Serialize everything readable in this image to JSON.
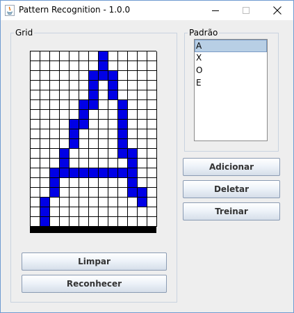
{
  "window": {
    "title": "Pattern Recognition - 1.0.0"
  },
  "grid_group": {
    "title": "Grid"
  },
  "grid": {
    "rows": 18,
    "cols": 13,
    "filled": [
      [
        1,
        7
      ],
      [
        2,
        7
      ],
      [
        3,
        6
      ],
      [
        3,
        7
      ],
      [
        3,
        8
      ],
      [
        4,
        6
      ],
      [
        4,
        8
      ],
      [
        5,
        6
      ],
      [
        5,
        8
      ],
      [
        6,
        5
      ],
      [
        6,
        6
      ],
      [
        6,
        9
      ],
      [
        7,
        5
      ],
      [
        7,
        9
      ],
      [
        8,
        4
      ],
      [
        8,
        5
      ],
      [
        8,
        9
      ],
      [
        9,
        4
      ],
      [
        9,
        9
      ],
      [
        10,
        4
      ],
      [
        10,
        9
      ],
      [
        11,
        3
      ],
      [
        11,
        9
      ],
      [
        11,
        10
      ],
      [
        12,
        3
      ],
      [
        12,
        10
      ],
      [
        13,
        2
      ],
      [
        13,
        3
      ],
      [
        13,
        4
      ],
      [
        13,
        5
      ],
      [
        13,
        6
      ],
      [
        13,
        7
      ],
      [
        13,
        8
      ],
      [
        13,
        9
      ],
      [
        13,
        10
      ],
      [
        14,
        2
      ],
      [
        14,
        10
      ],
      [
        15,
        2
      ],
      [
        15,
        10
      ],
      [
        15,
        11
      ],
      [
        16,
        1
      ],
      [
        16,
        11
      ],
      [
        17,
        1
      ],
      [
        18,
        1
      ]
    ]
  },
  "buttons": {
    "clear": "Limpar",
    "recognize": "Reconhecer",
    "add": "Adicionar",
    "delete": "Deletar",
    "train": "Treinar"
  },
  "pattern_group": {
    "title": "Padrão",
    "items": [
      "A",
      "X",
      "O",
      "E"
    ],
    "selected": "A"
  }
}
